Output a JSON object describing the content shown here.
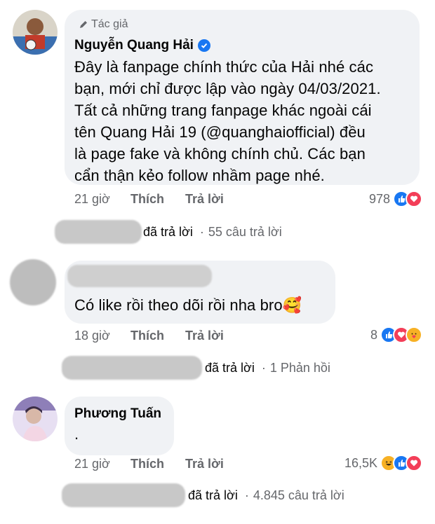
{
  "comments": [
    {
      "author_tag": "Tác giả",
      "author": "Nguyễn Quang Hải",
      "text": "Đây là fanpage chính thức của Hải nhé các\nbạn, mới chỉ được lập vào ngày 04/03/2021.\nTất cả những trang fanpage khác ngoài cái\ntên Quang Hải 19  (@quanghaiofficial) đều\nlà page fake và không chính chủ. Các bạn\ncẩn thận kẻo follow nhầm page nhé.",
      "time": "21 giờ",
      "like_label": "Thích",
      "reply_label": "Trả lời",
      "reaction_count": "978",
      "reactions": [
        "like-icon",
        "love-icon"
      ],
      "thread_replied": "đã trả lời",
      "thread_count": "55 câu trả lời"
    },
    {
      "text": "Có like rồi theo dõi rồi nha bro🥰",
      "time": "18 giờ",
      "like_label": "Thích",
      "reply_label": "Trả lời",
      "reaction_count": "8",
      "reactions": [
        "like-icon",
        "love-icon",
        "care-icon"
      ],
      "thread_replied": "đã trả lời",
      "thread_count": "1 Phản hồi"
    },
    {
      "author": "Phương Tuấn",
      "text": ".",
      "time": "21 giờ",
      "like_label": "Thích",
      "reply_label": "Trả lời",
      "reaction_count": "16,5K",
      "reactions": [
        "haha-icon",
        "like-icon",
        "love-icon"
      ],
      "thread_replied": "đã trả lời",
      "thread_count": "4.845 câu trả lời"
    }
  ],
  "separator": "·",
  "colors": {
    "bubble": "#f0f2f5",
    "secondary_text": "#65676b",
    "verified": "#1877f2"
  }
}
